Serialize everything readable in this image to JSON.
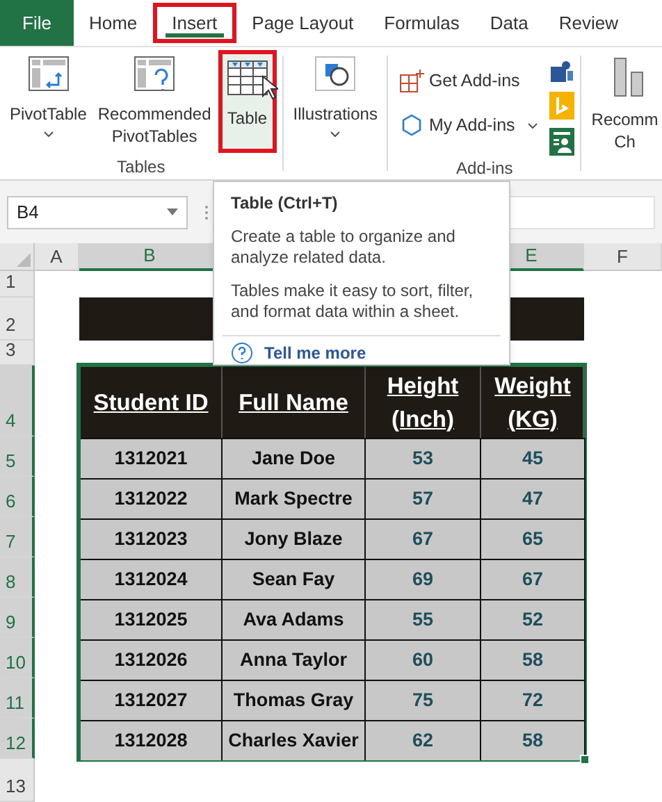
{
  "tabs": [
    {
      "label": "File",
      "kind": "file",
      "selected": false,
      "highlighted": false
    },
    {
      "label": "Home",
      "kind": "tab",
      "selected": false,
      "highlighted": false
    },
    {
      "label": "Insert",
      "kind": "tab",
      "selected": true,
      "highlighted": true
    },
    {
      "label": "Page Layout",
      "kind": "tab",
      "selected": false,
      "highlighted": false
    },
    {
      "label": "Formulas",
      "kind": "tab",
      "selected": false,
      "highlighted": false
    },
    {
      "label": "Data",
      "kind": "tab",
      "selected": false,
      "highlighted": false
    },
    {
      "label": "Review",
      "kind": "tab",
      "selected": false,
      "highlighted": false
    }
  ],
  "ribbon": {
    "groups": [
      {
        "label": "Tables",
        "items": [
          {
            "kind": "pivot",
            "lines": [
              "PivotTable"
            ],
            "dropdown": true,
            "highlighted": false
          },
          {
            "kind": "recommended",
            "lines": [
              "Recommended",
              "PivotTables"
            ],
            "dropdown": false,
            "highlighted": false
          },
          {
            "kind": "table",
            "lines": [
              "Table"
            ],
            "dropdown": false,
            "highlighted": true
          }
        ]
      },
      {
        "items": [
          {
            "kind": "illustrations",
            "lines": [
              "Illustrations"
            ],
            "dropdown": true,
            "highlighted": false
          }
        ]
      },
      {
        "label": "Add-ins",
        "items": [
          {
            "kind": "get-addins",
            "lines": [
              "Get Add-ins"
            ],
            "dropdown": false,
            "highlighted": false
          },
          {
            "kind": "my-addins",
            "lines": [
              "My Add-ins"
            ],
            "dropdown": true,
            "highlighted": false
          }
        ]
      },
      {
        "items": [
          {
            "kind": "charts",
            "lines": [
              "Recomm",
              "Ch"
            ],
            "dropdown": false,
            "highlighted": false
          }
        ]
      }
    ]
  },
  "name_box": {
    "value": "B4"
  },
  "tooltip": {
    "title": "Table (Ctrl+T)",
    "paragraphs": [
      "Create a table to organize and analyze related data.",
      "Tables make it easy to sort, filter, and format data within a sheet."
    ],
    "link": "Tell me more"
  },
  "column_headers": [
    {
      "label": "A",
      "selected": false
    },
    {
      "label": "B",
      "selected": true
    },
    {
      "label": "E",
      "selected": true
    },
    {
      "label": "F",
      "selected": false
    }
  ],
  "row_headers": [
    {
      "label": "1",
      "selected": false
    },
    {
      "label": "2",
      "selected": false
    },
    {
      "label": "3",
      "selected": false
    },
    {
      "label": "4",
      "selected": true
    },
    {
      "label": "5",
      "selected": true
    },
    {
      "label": "6",
      "selected": true
    },
    {
      "label": "7",
      "selected": true
    },
    {
      "label": "8",
      "selected": true
    },
    {
      "label": "9",
      "selected": true
    },
    {
      "label": "10",
      "selected": true
    },
    {
      "label": "11",
      "selected": true
    },
    {
      "label": "12",
      "selected": true
    },
    {
      "label": "13",
      "selected": false
    }
  ],
  "table": {
    "columns": [
      "Student ID",
      "Full Name",
      "Height (Inch)",
      "Weight (KG)"
    ],
    "rows": [
      [
        "1312021",
        "Jane Doe",
        "53",
        "45"
      ],
      [
        "1312022",
        "Mark Spectre",
        "57",
        "47"
      ],
      [
        "1312023",
        "Jony Blaze",
        "67",
        "65"
      ],
      [
        "1312024",
        "Sean Fay",
        "69",
        "67"
      ],
      [
        "1312025",
        "Ava Adams",
        "55",
        "52"
      ],
      [
        "1312026",
        "Anna Taylor",
        "60",
        "58"
      ],
      [
        "1312027",
        "Thomas Gray",
        "75",
        "72"
      ],
      [
        "1312028",
        "Charles Xavier",
        "62",
        "58"
      ]
    ]
  }
}
